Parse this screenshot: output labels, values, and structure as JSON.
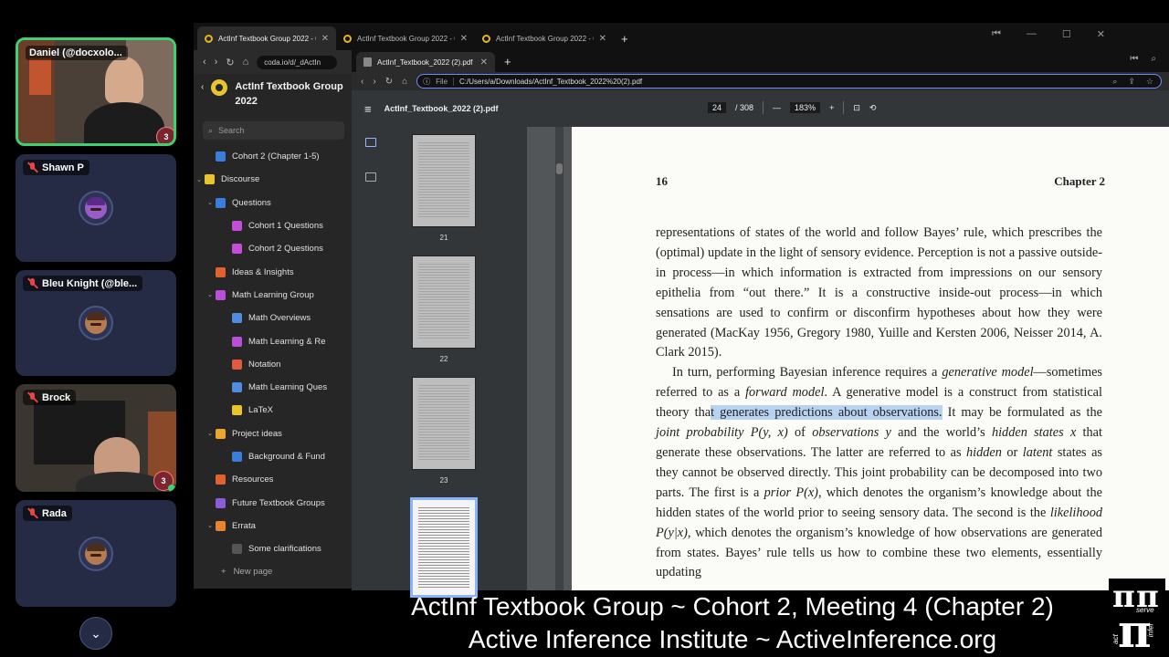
{
  "participants": [
    {
      "name": "Daniel (@docxolo...",
      "muted": false,
      "badge": "3"
    },
    {
      "name": "Shawn P",
      "muted": true
    },
    {
      "name": "Bleu Knight (@ble...",
      "muted": true
    },
    {
      "name": "Brock",
      "muted": true,
      "badge": "3"
    },
    {
      "name": "Rada",
      "muted": true
    }
  ],
  "back_browser": {
    "tabs": [
      {
        "title": "ActInf Textbook Group 2022 - Coda"
      },
      {
        "title": "ActInf Textbook Group 2022 - Coda"
      },
      {
        "title": "ActInf Textbook Group 2022 - Coda"
      }
    ],
    "url": "coda.io/d/_dActIn",
    "doc_title": "ActInf Textbook Group 2022",
    "search_placeholder": "Search",
    "nav": [
      {
        "label": "Cohort 2 (Chapter 1-5)",
        "icon_color": "#3b7ddd",
        "chev": ""
      },
      {
        "label": "Discourse",
        "icon_color": "#e9c52d",
        "chev": "⌄"
      },
      {
        "label": "Questions",
        "icon_color": "#3b7ddd",
        "chev": "⌄"
      },
      {
        "label": "Cohort 1 Questions",
        "icon_color": "#c24fd6",
        "chev": ""
      },
      {
        "label": "Cohort 2 Questions",
        "icon_color": "#c24fd6",
        "chev": ""
      },
      {
        "label": "Ideas & Insights",
        "icon_color": "#e2622f",
        "chev": ""
      },
      {
        "label": "Math Learning Group",
        "icon_color": "#b84fd6",
        "chev": "⌄"
      },
      {
        "label": "Math Overviews",
        "icon_color": "#4f8de0",
        "chev": ""
      },
      {
        "label": "Math Learning & Re",
        "icon_color": "#b84fd6",
        "chev": ""
      },
      {
        "label": "Notation",
        "icon_color": "#e05a3f",
        "chev": ""
      },
      {
        "label": "Math Learning Ques",
        "icon_color": "#4f8de0",
        "chev": ""
      },
      {
        "label": "LaTeX",
        "icon_color": "#e9c52d",
        "chev": ""
      },
      {
        "label": "Project ideas",
        "icon_color": "#e9a72d",
        "chev": "⌄"
      },
      {
        "label": "Background & Fund",
        "icon_color": "#3b7ddd",
        "chev": ""
      },
      {
        "label": "Resources",
        "icon_color": "#e2622f",
        "chev": ""
      },
      {
        "label": "Future Textbook Groups",
        "icon_color": "#8a5cd6",
        "chev": ""
      },
      {
        "label": "Errata",
        "icon_color": "#e9832d",
        "chev": "⌄"
      },
      {
        "label": "Some clarifications",
        "icon_color": "#555",
        "chev": ""
      }
    ],
    "new_page": "New page"
  },
  "pdf_browser": {
    "tab_title": "ActInf_Textbook_2022 (2).pdf",
    "url_label": "File",
    "url": "C:/Users/a/Downloads/ActInf_Textbook_2022%20(2).pdf",
    "file_name": "ActInf_Textbook_2022 (2).pdf",
    "page_current": "24",
    "page_total": "/ 308",
    "zoom": "183%",
    "thumbnails": [
      "21",
      "22",
      "23",
      ""
    ],
    "selected_thumbnail_index": 3,
    "page_header_left": "16",
    "page_header_right": "Chapter 2",
    "paragraph1": "representations of states of the world and follow Bayes’ rule, which prescribes the (optimal) update in the light of sensory evidence. Perception is not a passive outside-in process—in which information is extracted from impressions on our sensory epithelia from “out there.” It is a constructive inside-out process—in which sensations are used to confirm or disconfirm hypotheses about how they were generated (MacKay 1956, Gregory 1980, Yuille and Kersten 2006, Neisser 2014, A. Clark 2015).",
    "p2_a": "In turn, performing Bayesian inference requires a ",
    "p2_b": "generative model",
    "p2_c": "—sometimes referred to as a ",
    "p2_d": "forward model",
    "p2_e": ". A generative model is a construct from statistical theory tha",
    "p2_highlight": "t generates predictions about observations.",
    "p2_f": " It may be formulated as the ",
    "p2_g": "joint probability P(y, x)",
    "p2_h": " of ",
    "p2_i": "observations y",
    "p2_j": " and the world’s ",
    "p2_k": "hidden states x",
    "p2_l": " that generate these observations. The latter are referred to as ",
    "p2_m": "hidden",
    "p2_n": " or ",
    "p2_o": "latent",
    "p2_p": " states as they cannot be observed directly. This joint probability can be decomposed into two parts. The first is a ",
    "p2_q": "prior P(x)",
    "p2_r": ", which denotes the organism’s knowledge about the hidden states of the world prior to seeing sensory data. The second is the ",
    "p2_s": "likelihood P(y|x)",
    "p2_t": ", which denotes the organism’s knowledge of how observations are generated from states. Bayes’ rule tells us how to combine these two elements, essentially updating"
  },
  "caption": {
    "line1": "ActInf Textbook Group ~ Cohort 2, Meeting 4 (Chapter 2)",
    "line2": "Active Inference Institute ~ ActiveInference.org"
  },
  "logo": {
    "top": "serve",
    "middle": "infer",
    "left": "act"
  }
}
